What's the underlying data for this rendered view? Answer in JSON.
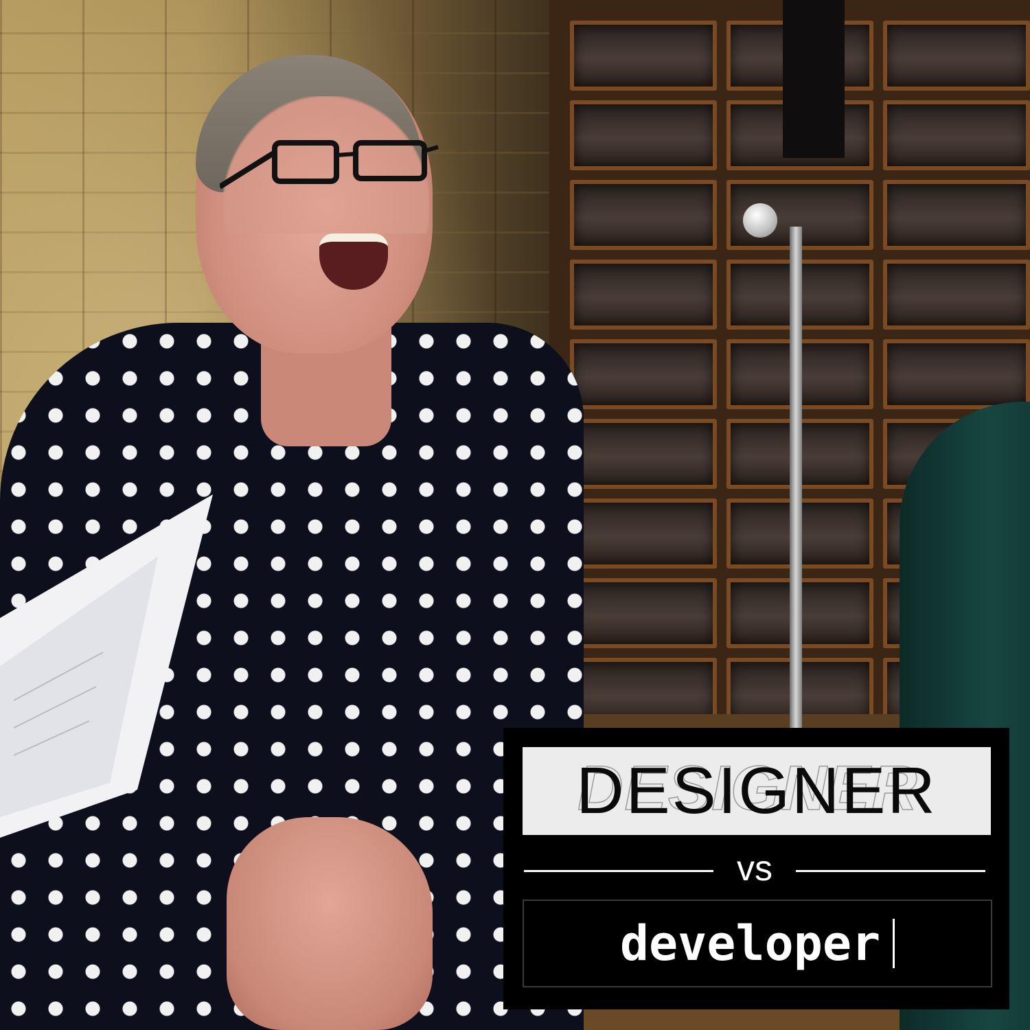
{
  "photo": {
    "subject": "laughing-man-in-polka-dot-shirt"
  },
  "overlay": {
    "designer_label": "DESIGNER",
    "vs_label": "vs",
    "developer_label": "developer",
    "colors": {
      "card_background": "#000000",
      "designer_box": "#ececec",
      "designer_text": "#0a0a0a",
      "light_text": "#ffffff"
    }
  }
}
